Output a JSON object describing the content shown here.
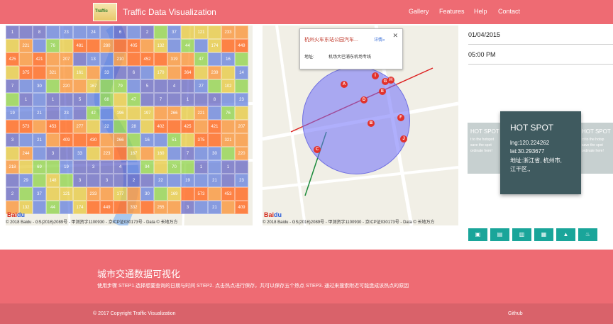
{
  "nav": {
    "brand": "Traffic Data Visualization",
    "logo_text": "Traffic",
    "items": [
      "Gallery",
      "Features",
      "Help",
      "Contact"
    ]
  },
  "heatmap": {
    "visible_counts": [
      "1",
      "2",
      "8",
      "22",
      "23",
      "19",
      "24",
      "21",
      "6",
      "23",
      "2",
      "42",
      "37",
      "196",
      "121",
      "197",
      "233",
      "266",
      "177",
      "221",
      "30",
      "76",
      "169",
      "481",
      "573",
      "280",
      "453",
      "405",
      "277",
      "132",
      "22",
      "44",
      "28",
      "174",
      "402",
      "449",
      "425",
      "332",
      "421",
      "255",
      "207",
      "3",
      "13",
      "21",
      "210",
      "409",
      "452",
      "430",
      "319",
      "266",
      "47",
      "16",
      "16",
      "51",
      "155",
      "375",
      "496",
      "321",
      "338",
      "161",
      "244",
      "33",
      "3",
      "6",
      "33",
      "170",
      "223",
      "364",
      "167",
      "239",
      "160",
      "14",
      "7",
      "28",
      "30",
      "76",
      "220",
      "218",
      "167",
      "69",
      "79",
      "19",
      "5",
      "3",
      "4",
      "4",
      "27",
      "94",
      "102",
      "70",
      "42",
      "1",
      "12",
      "1",
      "1",
      "5",
      "29",
      "68",
      "148",
      "47",
      "3",
      "7",
      "3"
    ],
    "copyright": "© 2018 Baidu - GS(2016)2089号 - 甲测资字1100930 - 京ICP证030173号 - Data © 长地万方"
  },
  "map2": {
    "popup_title": "杭州火车东站公园汽车...",
    "popup_detail": "详情»",
    "popup_addr_label": "地址:",
    "popup_addr": "机场大巴浦东机场专线",
    "pins": [
      "A",
      "B",
      "C",
      "D",
      "E",
      "F",
      "G",
      "H",
      "I",
      "J"
    ],
    "copyright": "© 2018 Baidu - GS(2016)2089号 - 甲测资字1100930 - 京ICP证030173号 - Data © 长地万方"
  },
  "form": {
    "date": "01/04/2015",
    "time": "05:00 PM"
  },
  "hotspot": {
    "title": "HOT SPOT",
    "lng": "lng:120.224262",
    "lat": "lat:30.293677",
    "addr1": "地址:浙江省, 杭州市,",
    "addr2": "江干区,,"
  },
  "side_card_left": {
    "title": "HOT SPOT",
    "l1": "t to the hotspot",
    "l2": "save the spot",
    "l3": "ordinate here!"
  },
  "side_card_right": {
    "title": "HOT SPOT",
    "l1": "ct to the hotsp",
    "l2": "save the spot",
    "l3": "ordinate here!"
  },
  "action_icons": [
    "camera-icon",
    "bus-icon",
    "train-icon",
    "subway-icon",
    "school-icon",
    "fire-icon"
  ],
  "footer": {
    "title": "城市交通数据可视化",
    "steps": "使用步骤 STEP1.选择想要查询的日期与时间 STEP2. 点击热点进行保存，共可以保存五个热点 STEP3. 通过来搜索附近可能造成该热点的原因",
    "copyright": "© 2017 Copyright Traffic Visualization",
    "github": "Github"
  },
  "colors": {
    "nav": "#ee6b73",
    "teal": "#1aa59a",
    "card": "#3f5a5f"
  }
}
